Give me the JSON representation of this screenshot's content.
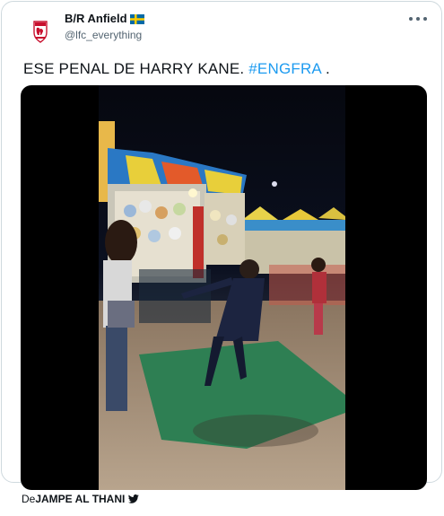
{
  "tweet": {
    "author_name": "B/R Anfield",
    "author_flag": "sweden-flag-icon",
    "author_handle": "@lfc_everything",
    "text_main": "ESE PENAL DE HARRY KANE. ",
    "hashtag": "#ENGFRA",
    "text_suffix": " .",
    "media_type": "video"
  },
  "attribution": {
    "prefix": "De",
    "name": "JAMPE AL THANI",
    "icon": "twitter-bird-icon"
  },
  "colors": {
    "link": "#1d9bf0",
    "muted": "#536471",
    "border": "#cfd9de",
    "text": "#0f1419",
    "brand_red": "#c8102e"
  }
}
